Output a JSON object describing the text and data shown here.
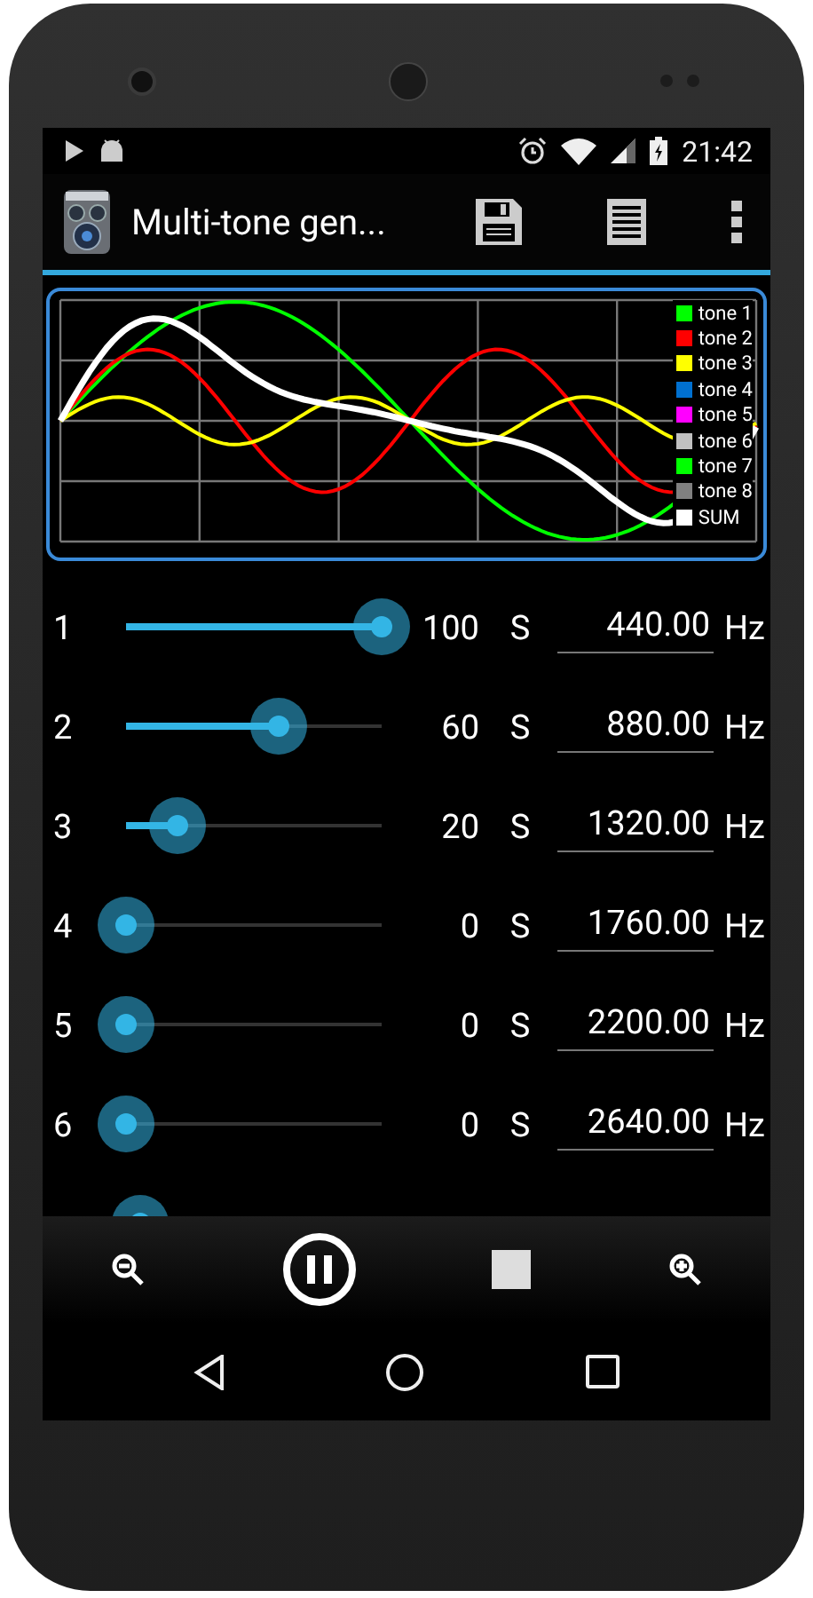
{
  "status_bar": {
    "time": "21:42"
  },
  "app_bar": {
    "title": "Multi-tone gen..."
  },
  "chart": {
    "kind": "picture",
    "legend": [
      {
        "label": "tone 1",
        "color": "#00ff00"
      },
      {
        "label": "tone 2",
        "color": "#ff0000"
      },
      {
        "label": "tone 3",
        "color": "#ffff00"
      },
      {
        "label": "tone 4",
        "color": "#0070d0"
      },
      {
        "label": "tone 5",
        "color": "#ff00ff"
      },
      {
        "label": "tone 6",
        "color": "#c0c0c0"
      },
      {
        "label": "tone 7",
        "color": "#00ff00"
      },
      {
        "label": "tone 8",
        "color": "#808080"
      },
      {
        "label": "SUM",
        "color": "#ffffff"
      }
    ]
  },
  "tones": [
    {
      "kind": "full",
      "number": "1",
      "level": 1.0,
      "value": "100",
      "sine": "S",
      "frequency": "440.00",
      "unit": "Hz"
    },
    {
      "kind": "full",
      "number": "2",
      "level": 0.6,
      "value": "60",
      "sine": "S",
      "frequency": "880.00",
      "unit": "Hz"
    },
    {
      "kind": "full",
      "number": "3",
      "level": 0.2,
      "value": "20",
      "sine": "S",
      "frequency": "1320.00",
      "unit": "Hz"
    },
    {
      "kind": "full",
      "number": "4",
      "level": 0,
      "value": "0",
      "sine": "S",
      "frequency": "1760.00",
      "unit": "Hz"
    },
    {
      "kind": "full",
      "number": "5",
      "level": 0,
      "value": "0",
      "sine": "S",
      "frequency": "2200.00",
      "unit": "Hz"
    },
    {
      "kind": "full",
      "number": "6",
      "level": 0,
      "value": "0",
      "sine": "S",
      "frequency": "2640.00",
      "unit": "Hz"
    },
    {
      "kind": "cut"
    }
  ]
}
